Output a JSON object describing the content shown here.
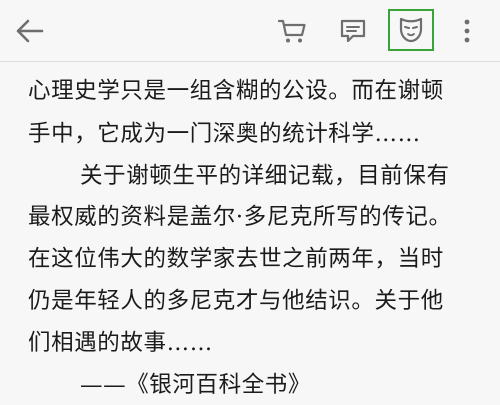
{
  "toolbar": {
    "back_icon": "arrow-left-icon",
    "cart_icon": "cart-icon",
    "comment_icon": "comment-icon",
    "mask_icon": "mask-icon",
    "more_icon": "more-vertical-icon",
    "highlight_color": "#3aa43a",
    "icon_color": "#6e6e6e"
  },
  "reader": {
    "lines": [
      "心理史学只是一组含糊的公设。而在谢顿",
      "手中，它成为一门深奥的统计科学……",
      "关于谢顿生平的详细记载，目前保有",
      "最权威的资料是盖尔·多尼克所写的传记。",
      "在这位伟大的数学家去世之前两年，当时",
      "仍是年轻人的多尼克才与他结识。关于他",
      "们相遇的故事……",
      "——《银河百科全书》"
    ]
  }
}
